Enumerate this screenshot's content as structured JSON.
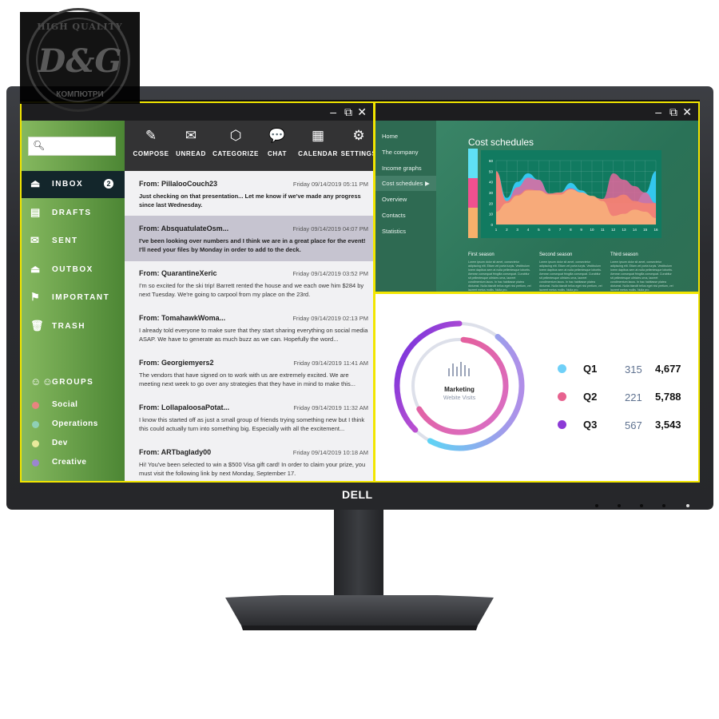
{
  "watermark": {
    "top_text": "HIGH QUALITY",
    "logo": "D&G",
    "sub_text": "КОМПЮТРИ"
  },
  "monitor": {
    "brand": "DELL"
  },
  "mail_app": {
    "window_controls": {
      "minimize": "–",
      "restore": "⧉",
      "close": "✕"
    },
    "search": {
      "placeholder": "",
      "value": "",
      "icon": "search-icon"
    },
    "toolbar": [
      {
        "label": "COMPOSE",
        "icon": "✎",
        "name": "pencil-icon"
      },
      {
        "label": "UNREAD",
        "icon": "✉",
        "name": "envelope-icon"
      },
      {
        "label": "CATEGORIZE",
        "icon": "⬡",
        "name": "tag-icon"
      },
      {
        "label": "CHAT",
        "icon": "💬",
        "name": "chat-bubble-icon"
      },
      {
        "label": "CALENDAR",
        "icon": "▦",
        "name": "calendar-icon"
      },
      {
        "label": "SETTINGS",
        "icon": "⚙",
        "name": "gear-icon"
      }
    ],
    "folders": [
      {
        "label": "INBOX",
        "icon": "⏏",
        "badge": "2",
        "active": true
      },
      {
        "label": "DRAFTS",
        "icon": "▤"
      },
      {
        "label": "SENT",
        "icon": "✉"
      },
      {
        "label": "OUTBOX",
        "icon": "⏏"
      },
      {
        "label": "IMPORTANT",
        "icon": "⚑"
      },
      {
        "label": "TRASH",
        "icon": "🗑"
      }
    ],
    "groups_header": "GROUPS",
    "groups": [
      {
        "label": "Social",
        "color": "#e88480"
      },
      {
        "label": "Operations",
        "color": "#8fd0b5"
      },
      {
        "label": "Dev",
        "color": "#e8ea9b"
      },
      {
        "label": "Creative",
        "color": "#9b86cf"
      }
    ],
    "messages": [
      {
        "from": "From: PillalooCouch23",
        "date": "Friday 09/14/2019 05:11 PM",
        "body": "Just checking on that presentation... Let me know if we've made any progress since last Wednesday.",
        "unread": true
      },
      {
        "from": "From: AbsquatulateOsm...",
        "date": "Friday 09/14/2019 04:07 PM",
        "body": "I've been looking over numbers and I think we are in a great place for the event! I'll need your files by Monday in order to add to the deck.",
        "unread": true,
        "selected": true
      },
      {
        "from": "From: QuarantineXeric",
        "date": "Friday 09/14/2019 03:52 PM",
        "body": "I'm so excited for the ski trip! Barrett rented the house and we each owe him $284 by next Tuesday. We're going to carpool from my place on the 23rd."
      },
      {
        "from": "From: TomahawkWoma...",
        "date": "Friday 09/14/2019 02:13 PM",
        "body": "I already told everyone to make sure that they start sharing everything on social media ASAP. We have to generate as much buzz as we can. Hopefully the word..."
      },
      {
        "from": "From: Georgiemyers2",
        "date": "Friday 09/14/2019 11:41 AM",
        "body": "The vendors that have signed on to work with us are extremely excited. We are meeting next week to go over any strategies that they have in mind to make this..."
      },
      {
        "from": "From: LollapaloosaPotat...",
        "date": "Friday 09/14/2019 11:32 AM",
        "body": "I know this started off as just a small group of friends trying something new but I think this could actually turn into something big. Especially with all the excitement..."
      },
      {
        "from": "From: ARTbaglady00",
        "date": "Friday 09/14/2019 10:18 AM",
        "body": "Hi! You've been selected to win a $500 Visa gift card! In order to claim your prize, you must visit the following link by next Monday, September 17."
      }
    ]
  },
  "cost_app": {
    "window_controls": {
      "minimize": "–",
      "restore": "⧉",
      "close": "✕"
    },
    "nav": [
      {
        "label": "Home"
      },
      {
        "label": "The company"
      },
      {
        "label": "Income graphs"
      },
      {
        "label": "Cost schedules",
        "active": true,
        "arrow": "▶"
      },
      {
        "label": "Overview"
      },
      {
        "label": "Contacts"
      },
      {
        "label": "Statistics"
      }
    ],
    "title": "Cost schedules",
    "seasons": [
      {
        "title": "First season",
        "text": "Lorem ipsum dolor sit amet, consectetur adipiscing elit. Etiam vel porta turpis. Vestibulum lorem dapibus sem at nulla pellentesque lobortis. Aenean consequat fringilla consequat. Curabitur sit pellentesque ultricies urna, laoreet condimentum lacus. In hac habitasse platea dictumst. Nulla blandit tellus eget nisi pretium, vel laoreet metus mollis. Nulla pro."
      },
      {
        "title": "Second season",
        "text": "Lorem ipsum dolor sit amet, consectetur adipiscing elit. Etiam vel porta turpis. Vestibulum lorem dapibus sem at nulla pellentesque lobortis. Aenean consequat fringilla consequat. Curabitur sit pellentesque ultricies urna, laoreet condimentum lacus. In hac habitasse platea dictumst. Nulla blandit tellus eget nisi pretium, vel laoreet metus mollis. Nulla pro."
      },
      {
        "title": "Third season",
        "text": "Lorem ipsum dolor sit amet, consectetur adipiscing elit. Etiam vel porta turpis. Vestibulum lorem dapibus sem at nulla pellentesque lobortis. Aenean consequat fringilla consequat. Curabitur sit pellentesque ultricies urna, laoreet condimentum lacus. In hac habitasse platea dictumst. Nulla blandit tellus eget nisi pretium, vel laoreet metus mollis. Nulla pro."
      }
    ],
    "legend_colors": [
      "#5fe0f5",
      "#f0508f",
      "#f7b06b"
    ]
  },
  "chart_data": [
    {
      "type": "area",
      "title": "Cost schedules",
      "x": [
        1,
        2,
        3,
        4,
        5,
        6,
        7,
        8,
        9,
        10,
        11,
        12,
        13,
        14,
        15,
        16
      ],
      "ylim": [
        0,
        60
      ],
      "yticks": [
        0,
        10,
        20,
        30,
        40,
        50,
        60
      ],
      "grid": true,
      "series": [
        {
          "name": "cyan",
          "color": "#33c7ef",
          "values": [
            50,
            25,
            40,
            48,
            42,
            29,
            30,
            39,
            32,
            26,
            22,
            20,
            20,
            20,
            30,
            50
          ]
        },
        {
          "name": "pink",
          "color": "#e2679c",
          "values": [
            50,
            22,
            35,
            44,
            42,
            29,
            30,
            34,
            30,
            26,
            24,
            48,
            42,
            36,
            30,
            20
          ]
        },
        {
          "name": "salmon",
          "color": "#f7846f",
          "values": [
            50,
            22,
            28,
            33,
            32,
            29,
            30,
            33,
            30,
            26,
            24,
            25,
            28,
            22,
            20,
            20
          ]
        },
        {
          "name": "orange",
          "color": "#f8b27a",
          "values": [
            12,
            20,
            27,
            32,
            32,
            28,
            28,
            33,
            30,
            27,
            22,
            8,
            10,
            14,
            12,
            6
          ]
        }
      ]
    },
    {
      "type": "pie",
      "title": "Marketing",
      "subtitle": "Webite Visits",
      "categories": [
        "Q1",
        "Q2",
        "Q3"
      ],
      "series": [
        {
          "name": "visits",
          "values": [
            315,
            221,
            567
          ]
        },
        {
          "name": "totals",
          "values": [
            4677,
            5788,
            3543
          ]
        }
      ],
      "colors": [
        "#5ec8f7",
        "#e4608e",
        "#8a3ed8"
      ]
    }
  ],
  "marketing": {
    "title": "Marketing",
    "subtitle": "Webite Visits",
    "rows": [
      {
        "q": "Q1",
        "visits": "315",
        "total": "4,677",
        "color": "#6fd0f8"
      },
      {
        "q": "Q2",
        "visits": "221",
        "total": "5,788",
        "color": "#e7628f"
      },
      {
        "q": "Q3",
        "visits": "567",
        "total": "3,543",
        "color": "#8c3ad6"
      }
    ]
  }
}
